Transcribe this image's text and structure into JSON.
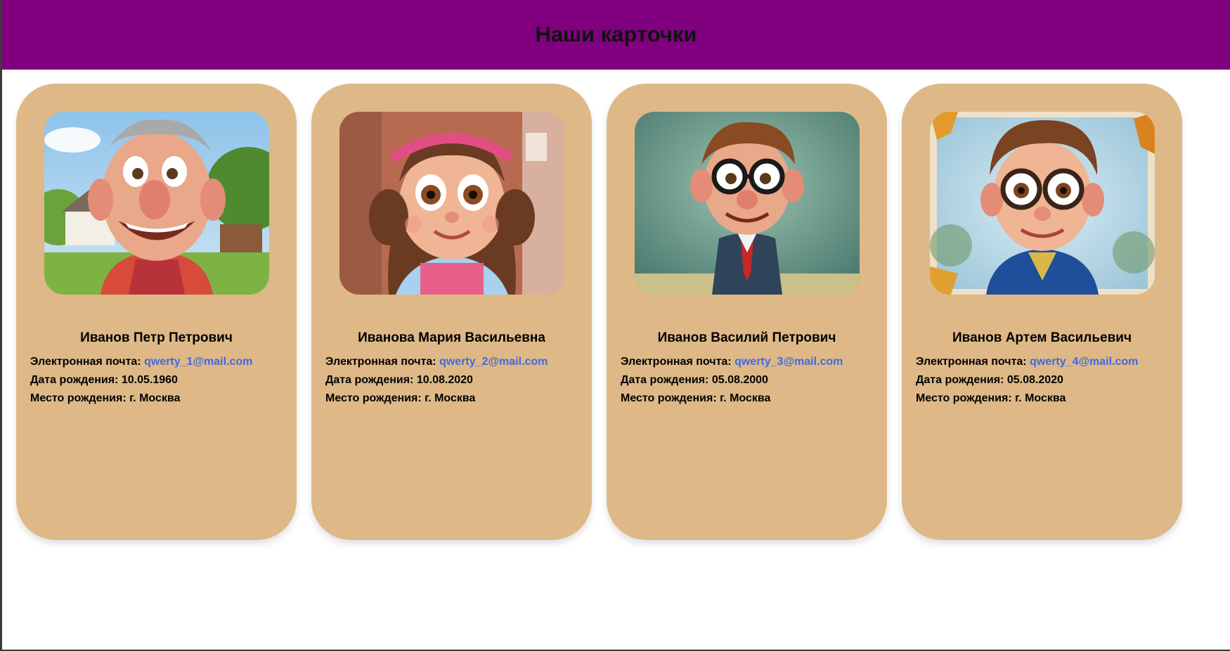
{
  "page": {
    "title": "Наши карточки",
    "header_color": "#800080",
    "card_color": "#deb887",
    "link_color": "#4169e1"
  },
  "labels": {
    "email": "Электронная почта:",
    "birth_date": "Дата рождения:",
    "birth_place": "Место рождения:"
  },
  "cards": [
    {
      "name": "Иванов Петр Петрович",
      "email": "qwerty_1@mail.com",
      "birth_date": "10.05.1960",
      "birth_place": "г. Москва",
      "photo": "cartoon-old-man-portrait"
    },
    {
      "name": "Иванова Мария Васильевна",
      "email": "qwerty_2@mail.com",
      "birth_date": "10.08.2020",
      "birth_place": "г. Москва",
      "photo": "cartoon-girl-portrait"
    },
    {
      "name": "Иванов Василий Петрович",
      "email": "qwerty_3@mail.com",
      "birth_date": "05.08.2000",
      "birth_place": "г. Москва",
      "photo": "cartoon-man-in-suit-portrait"
    },
    {
      "name": "Иванов Артем Васильевич",
      "email": "qwerty_4@mail.com",
      "birth_date": "05.08.2020",
      "birth_place": "г. Москва",
      "photo": "cartoon-boy-with-glasses-portrait"
    }
  ]
}
